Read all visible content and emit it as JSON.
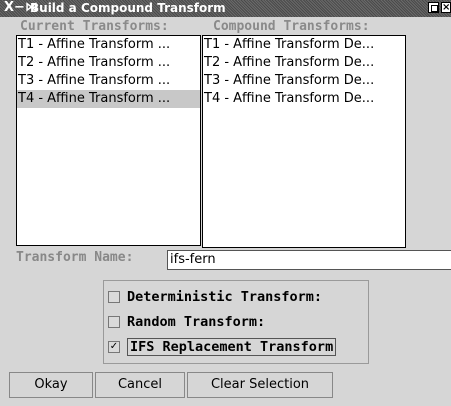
{
  "window": {
    "title": "Build a Compound Transform",
    "menu_glyph": "X−⋈",
    "close_glyph": "×"
  },
  "headers": {
    "current": "Current Transforms:",
    "compound": "Compound Transforms:"
  },
  "current_transforms": [
    {
      "label": "T1 - Affine Transform ...",
      "selected": false
    },
    {
      "label": "T2 - Affine Transform ...",
      "selected": false
    },
    {
      "label": "T3 - Affine Transform ...",
      "selected": false
    },
    {
      "label": "T4 - Affine Transform ...",
      "selected": true
    }
  ],
  "compound_transforms": [
    "T1 - Affine Transform De...",
    "T2 - Affine Transform De...",
    "T3 - Affine Transform De...",
    "T4 - Affine Transform De..."
  ],
  "transform_name": {
    "label": "Transform Name:",
    "value": "ifs-fern"
  },
  "transform_type": {
    "options": [
      {
        "label": "Deterministic Transform:",
        "checked": false
      },
      {
        "label": "Random Transform:",
        "checked": false
      },
      {
        "label": "IFS Replacement Transform",
        "checked": true
      }
    ],
    "check_glyph": "✓"
  },
  "buttons": {
    "okay": "Okay",
    "cancel": "Cancel",
    "clear": "Clear Selection"
  }
}
